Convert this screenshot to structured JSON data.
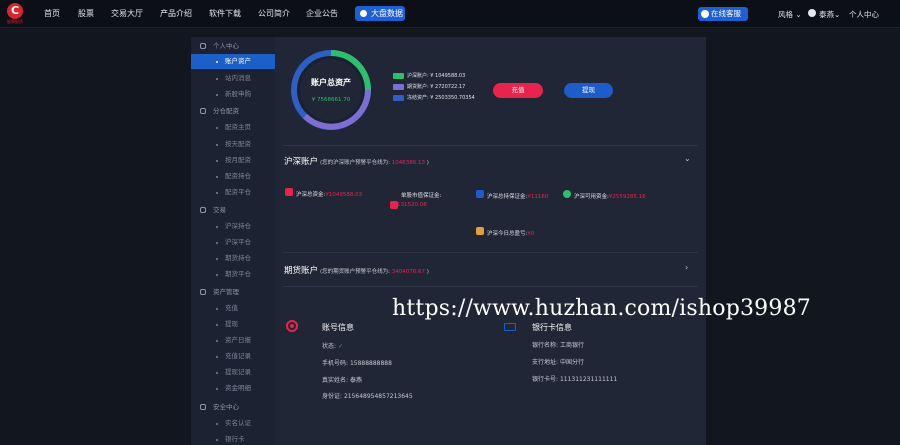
{
  "logo": {
    "letter": "C",
    "tagline": "股票配资"
  },
  "nav": {
    "items": [
      "首页",
      "股票",
      "交易大厅",
      "产品介绍",
      "软件下载",
      "公司简介",
      "企业公告"
    ],
    "hot_label": "大盘数据"
  },
  "topright": {
    "service_label": "在线客服",
    "style_label": "风格",
    "user_label": "泰燕",
    "center_label": "个人中心"
  },
  "sidebar": {
    "groups": [
      {
        "label": "个人中心",
        "items": [
          "账户资产",
          "站内消息",
          "新股申购"
        ]
      },
      {
        "label": "分仓配资",
        "items": [
          "配资主页",
          "按天配资",
          "按月配资",
          "配资持仓",
          "配资平仓"
        ]
      },
      {
        "label": "交易",
        "items": [
          "沪深持仓",
          "沪深平仓",
          "期货持仓",
          "期货平仓"
        ]
      },
      {
        "label": "资产管理",
        "items": [
          "充值",
          "提现",
          "资产日报",
          "充值记录",
          "提现记录",
          "资金明细"
        ]
      },
      {
        "label": "安全中心",
        "items": [
          "实名认证",
          "银行卡"
        ]
      }
    ]
  },
  "assets": {
    "title": "账户总资产",
    "total": "¥ 7568661.70",
    "legend": [
      {
        "label": "沪深账户: ¥ 1049588.03",
        "color": "#2dbf6b"
      },
      {
        "label": "期货账户: ¥ 2720722.17",
        "color": "#7d6fd1"
      },
      {
        "label": "冻结资产: ¥ 2503350.70354",
        "color": "#2f5ec4"
      }
    ],
    "recharge_label": "充值",
    "withdraw_label": "提现"
  },
  "hs_account": {
    "title": "沪深账户",
    "sub_prefix": "(您的沪深账户预警平仓线为:",
    "sub_value": "1046386.13",
    "sub_suffix": ")",
    "stats": [
      {
        "label": "沪深总资金:",
        "value": "¥1049588.03"
      },
      {
        "label": "单股市值保证金:",
        "value": "¥1131520.08"
      },
      {
        "label": "沪深总持保证金:",
        "value": "¥11160"
      },
      {
        "label": "沪深可用资金:",
        "value": "¥2559285.16"
      },
      {
        "label": "沪深今日总盈亏:",
        "value": "¥0"
      }
    ]
  },
  "ft_account": {
    "title": "期货账户",
    "sub_prefix": "(您的期货账户预警平仓线为:",
    "sub_value": "3404076.67",
    "sub_suffix": ")"
  },
  "account_info": {
    "title": "账号信息",
    "status_label": "状态:",
    "status_value": "✓",
    "phone_label": "手机号码:",
    "phone": "15888888888",
    "name_label": "真实姓名:",
    "name": "泰燕",
    "id_label": "身份证:",
    "id": "215648954857213645"
  },
  "bank_info": {
    "title": "银行卡信息",
    "bank_label": "银行名称:",
    "bank": "工商银行",
    "branch_label": "支行地址:",
    "branch": "中国分行",
    "card_label": "银行卡号:",
    "card": "111311231111111"
  },
  "watermark": "https://www.huzhan.com/ishop39987",
  "colors": {
    "accent_blue": "#1d5cc9",
    "accent_red": "#e8234e",
    "green": "#2dbf6b",
    "bg": "#12161f",
    "panel": "#202636"
  }
}
